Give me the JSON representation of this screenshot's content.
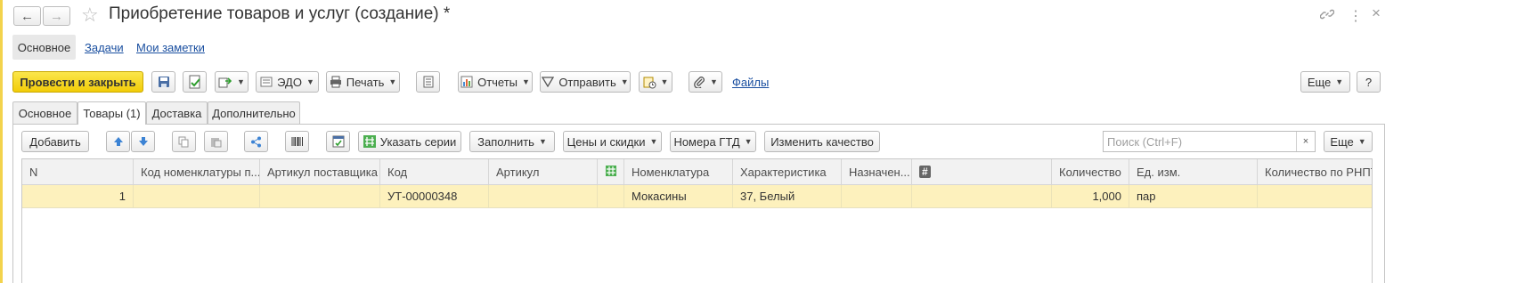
{
  "header": {
    "title": "Приобретение товаров и услуг (создание) *",
    "back_icon": "←",
    "forward_icon": "→",
    "star_icon": "☆",
    "link_icon": "🔗",
    "more_icon": "⋮",
    "close_icon": "×"
  },
  "sections": {
    "main": "Основное",
    "tasks": "Задачи",
    "notes": "Мои заметки"
  },
  "toolbar": {
    "post_close": "Провести и закрыть",
    "edo": "ЭДО",
    "print": "Печать",
    "reports": "Отчеты",
    "send": "Отправить",
    "files": "Файлы",
    "more": "Еще",
    "help": "?"
  },
  "tabs": [
    "Основное",
    "Товары (1)",
    "Доставка",
    "Дополнительно"
  ],
  "goods_toolbar": {
    "add": "Добавить",
    "series": "Указать серии",
    "fill": "Заполнить",
    "prices": "Цены и скидки",
    "gtd": "Номера ГТД",
    "quality": "Изменить качество",
    "search_placeholder": "Поиск (Ctrl+F)",
    "search_clear": "×",
    "more": "Еще"
  },
  "table": {
    "columns": [
      "N",
      "Код номенклатуры п...",
      "Артикул поставщика",
      "Код",
      "Артикул",
      "",
      "Номенклатура",
      "Характеристика",
      "Назначен...",
      "#",
      "Количество",
      "Ед. изм.",
      "Количество по РНПТ"
    ],
    "rows": [
      [
        "1",
        "",
        "",
        "УТ-00000348",
        "",
        "",
        "Мокасины",
        "37, Белый",
        "",
        "",
        "1,000",
        "пар",
        ""
      ]
    ]
  }
}
